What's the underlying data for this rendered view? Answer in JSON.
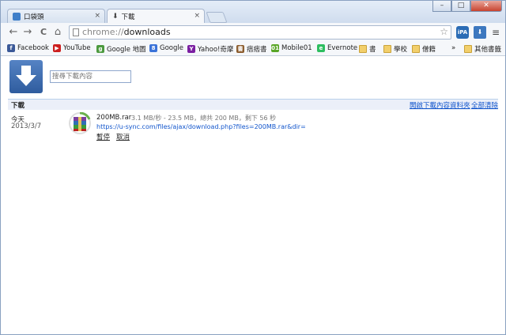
{
  "tabs": [
    {
      "title": "口袋頭",
      "close": "×"
    },
    {
      "title": "下載",
      "close": "×"
    }
  ],
  "window_controls": {
    "minimize": "–",
    "maximize": "□",
    "close": "✕"
  },
  "toolbar": {
    "back": "←",
    "forward": "→",
    "reload": "C",
    "home": "⌂",
    "url_scheme": "chrome://",
    "url_path": "downloads",
    "star": "☆",
    "ext_ipa": "iPA",
    "ext_download": "⬇",
    "menu": "≡"
  },
  "bookmarks": [
    {
      "label": "Facebook",
      "icon": "f"
    },
    {
      "label": "YouTube",
      "icon": "▶"
    },
    {
      "label": "Google 地圖",
      "icon": "g"
    },
    {
      "label": "Google",
      "icon": "8"
    },
    {
      "label": "Yahoo!奇摩",
      "icon": "Y"
    },
    {
      "label": "痞痞書",
      "icon": "書"
    },
    {
      "label": "Mobile01",
      "icon": "01"
    },
    {
      "label": "Evernote",
      "icon": "e"
    },
    {
      "label": "書",
      "icon": ""
    },
    {
      "label": "學校",
      "icon": ""
    },
    {
      "label": "僧籍",
      "icon": ""
    }
  ],
  "bookmarks_overflow": "»",
  "other_bookmarks": "其他書籤",
  "downloads_page": {
    "search_placeholder": "搜尋下載內容",
    "section_title": "下載",
    "open_folder_link": "開啟下載內容資料夾",
    "clear_all_link": "全部清除",
    "date_label": "今天",
    "date_value": "2013/3/7",
    "item": {
      "filename": "200MB.rar",
      "status": "3.1 MB/秒 - 23.5 MB，總共 200 MB，剩下 56 秒",
      "url": "https://u-sync.com/files/ajax/download.php?files=200MB.rar&dir=",
      "pause_label": "暫停",
      "cancel_label": "取消"
    }
  },
  "colors": {
    "link": "#1155cc",
    "download_icon_bg": "#3a6aae",
    "header_bg": "#ebeff9"
  }
}
